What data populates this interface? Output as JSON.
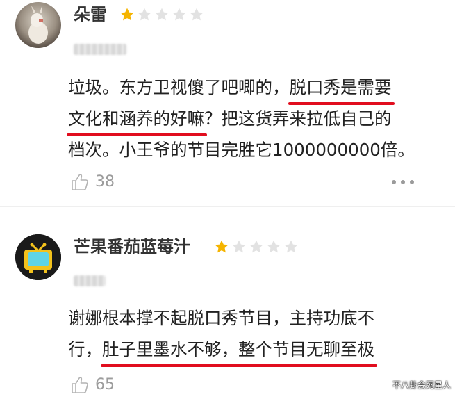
{
  "reviews": [
    {
      "username": "朵雷",
      "rating": 1,
      "rating_max": 5,
      "text": {
        "line1_a": "垃圾。东方卫视傻了吧唧的，",
        "line1_mark": "脱口秀是需要",
        "line2_mark": "文化和涵养的好嘛",
        "line2_b": "？把这货弄来拉低自己的",
        "line3": "档次。小王爷的节目完胜它1000000000倍。"
      },
      "likes": "38"
    },
    {
      "username": "芒果番茄蓝莓汁",
      "rating": 1,
      "rating_max": 5,
      "text": {
        "line1": "谢娜根本撑不起脱口秀节目，主持功底不",
        "line2_a": "行，",
        "line2_mark": "肚子里墨水不够，整个节目无聊至极"
      },
      "likes": "65"
    }
  ],
  "watermark": "不八卦会死星人",
  "colors": {
    "star_filled": "#f5b400",
    "star_empty": "#e2e2e2",
    "underline": "#e10d1e",
    "muted": "#9c9c9c"
  },
  "icons": {
    "like": "thumbs-up-icon",
    "more": "more-dots-icon",
    "star": "star-icon"
  }
}
